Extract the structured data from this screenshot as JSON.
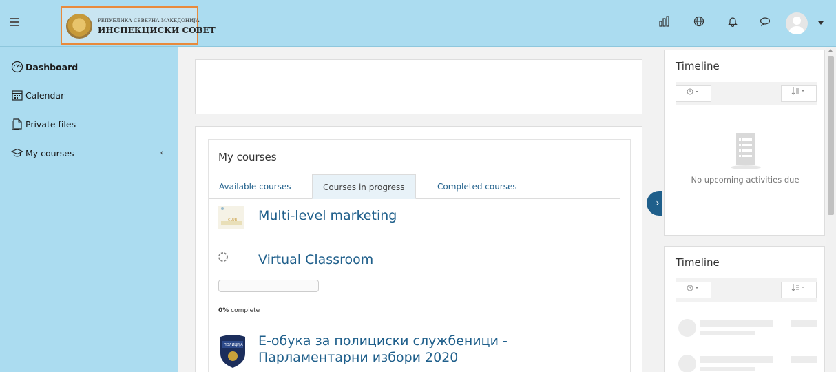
{
  "header": {
    "logo_line1": "РЕПУБЛИКА СЕВЕРНА МАКЕДОНИЈА",
    "logo_line2": "ИНСПЕКЦИСКИ СОВЕТ",
    "icons": [
      "menu-icon",
      "bar-chart-icon",
      "globe-icon",
      "bell-icon",
      "chat-icon",
      "user-avatar",
      "caret-down-icon"
    ]
  },
  "sidebar": {
    "items": [
      {
        "label": "Dashboard",
        "icon": "dashboard-icon",
        "active": true
      },
      {
        "label": "Calendar",
        "icon": "calendar-icon"
      },
      {
        "label": "Private files",
        "icon": "file-icon"
      },
      {
        "label": "My courses",
        "icon": "graduation-cap-icon",
        "collapse_icon": "chevron-left-icon"
      }
    ]
  },
  "main": {
    "courses_title": "My courses",
    "tabs": [
      {
        "label": "Available courses"
      },
      {
        "label": "Courses in progress",
        "active": true
      },
      {
        "label": "Completed courses"
      }
    ],
    "courses": [
      {
        "name": "Multi-level marketing"
      },
      {
        "name": "Virtual Classroom",
        "progress_percent": 0,
        "progress_value": "0%",
        "progress_suffix": " complete"
      },
      {
        "name": "Е-обука за полициски службеници - Парламентарни избори 2020"
      }
    ],
    "drawer_toggle": "›"
  },
  "right": {
    "timeline1_title": "Timeline",
    "timeline2_title": "Timeline",
    "empty_text": "No upcoming activities due",
    "filter_icon": "clock-icon",
    "sort_icon": "sort-icon"
  },
  "colors": {
    "navbar": "#abdcf0",
    "link": "#1f5f8b",
    "logo_border": "#e88a3c"
  }
}
